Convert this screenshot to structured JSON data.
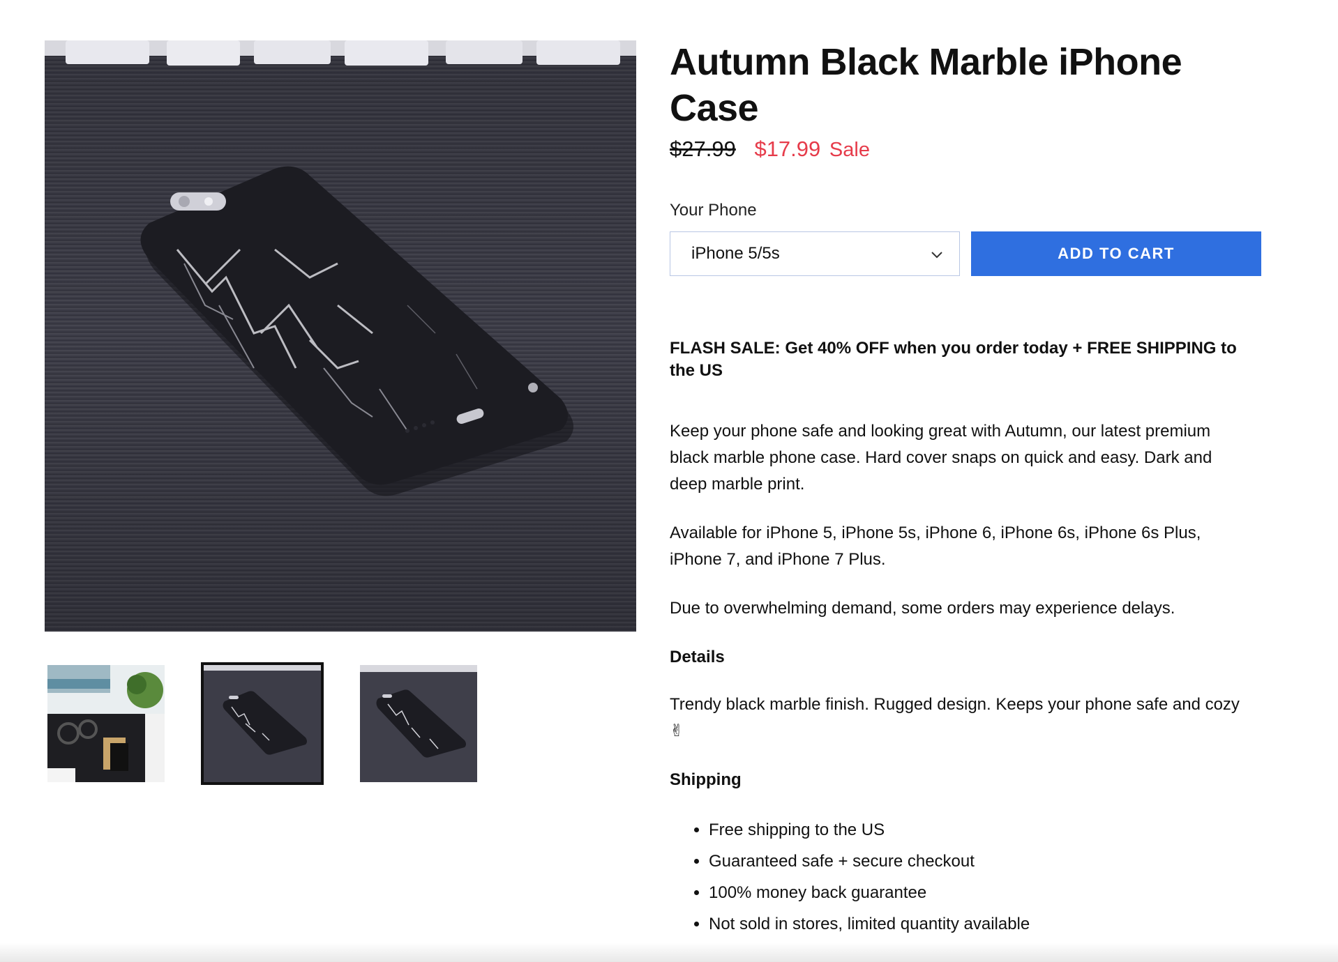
{
  "product": {
    "title": "Autumn Black Marble iPhone Case",
    "price_compare": "$27.99",
    "price_sale": "$17.99",
    "sale_label": "Sale"
  },
  "variant": {
    "label": "Your Phone",
    "selected": "iPhone 5/5s"
  },
  "cart": {
    "button_label": "ADD TO CART"
  },
  "description": {
    "flash_sale": "FLASH SALE: Get 40% OFF when you order today + FREE SHIPPING to the US",
    "intro": "Keep your phone safe and looking great with Autumn, our latest premium black marble phone case. Hard cover snaps on quick and easy. Dark and deep marble print.",
    "availability": "Available for iPhone 5, iPhone 5s, iPhone 6, iPhone 6s, iPhone 6s Plus, iPhone 7, and iPhone 7 Plus.",
    "demand": "Due to overwhelming demand, some orders may experience delays.",
    "details_heading": "Details",
    "details_text": "Trendy black marble finish. Rugged design. Keeps your phone safe and cozy",
    "details_emoji": "✌",
    "shipping_heading": "Shipping",
    "shipping_items": [
      "Free shipping to the US",
      "Guaranteed safe + secure checkout",
      "100% money back guarantee",
      "Not sold in stores, limited quantity available"
    ]
  },
  "colors": {
    "sale": "#e63b4a",
    "button": "#2f6fe0",
    "select_border": "#b8c6e4"
  },
  "icons": {
    "select_arrow": "chevron-down-icon"
  }
}
